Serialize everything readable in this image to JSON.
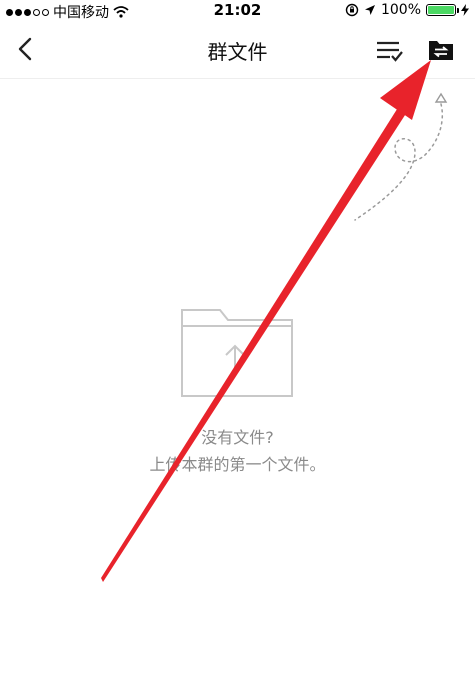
{
  "status_bar": {
    "carrier": "中国移动",
    "time": "21:02",
    "battery": "100%",
    "signal_bars": 5,
    "signal_filled": 3
  },
  "nav": {
    "title": "群文件"
  },
  "empty_state": {
    "title": "没有文件?",
    "subtitle": "上传本群的第一个文件。"
  },
  "icons": {
    "back": "back-chevron-icon",
    "list_check": "list-check-icon",
    "folder_switch": "folder-switch-icon",
    "empty_folder": "folder-upload-icon"
  },
  "colors": {
    "annotation": "#e8232b",
    "battery": "#4cd964",
    "empty_text": "#8a8a8a"
  }
}
